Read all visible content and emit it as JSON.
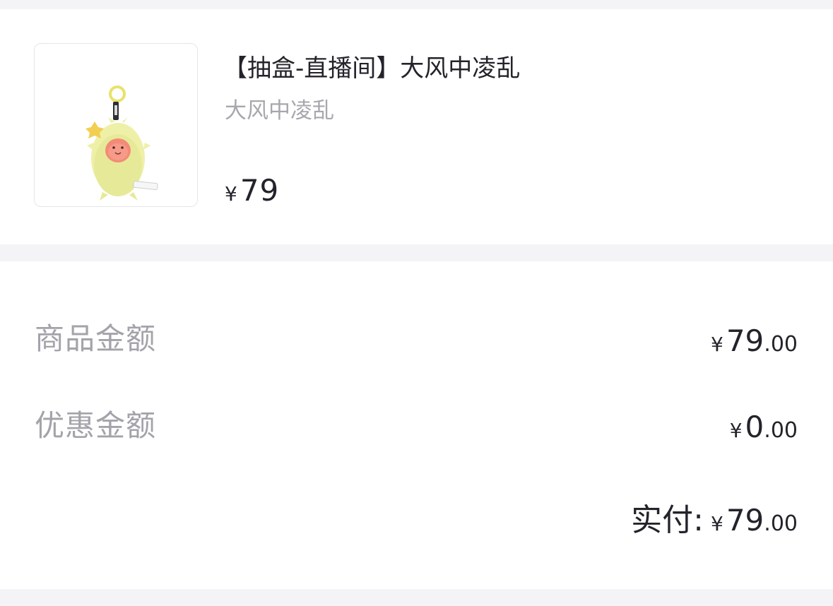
{
  "product": {
    "title": "【抽盒-直播间】大风中凌乱",
    "subtitle": "大风中凌乱",
    "currency": "¥",
    "price": "79",
    "image_icon": "plush-keychain-icon"
  },
  "summary": {
    "goods_amount": {
      "label": "商品金额",
      "currency": "¥",
      "int": "79",
      "dec": ".00"
    },
    "discount_amount": {
      "label": "优惠金额",
      "currency": "¥",
      "int": "0",
      "dec": ".00"
    },
    "paid": {
      "label": "实付:",
      "currency": "¥",
      "int": "79",
      "dec": ".00"
    }
  },
  "colors": {
    "background": "#f4f4f7",
    "card": "#ffffff",
    "text_primary": "#23232b",
    "text_secondary": "#a3a3aa"
  }
}
